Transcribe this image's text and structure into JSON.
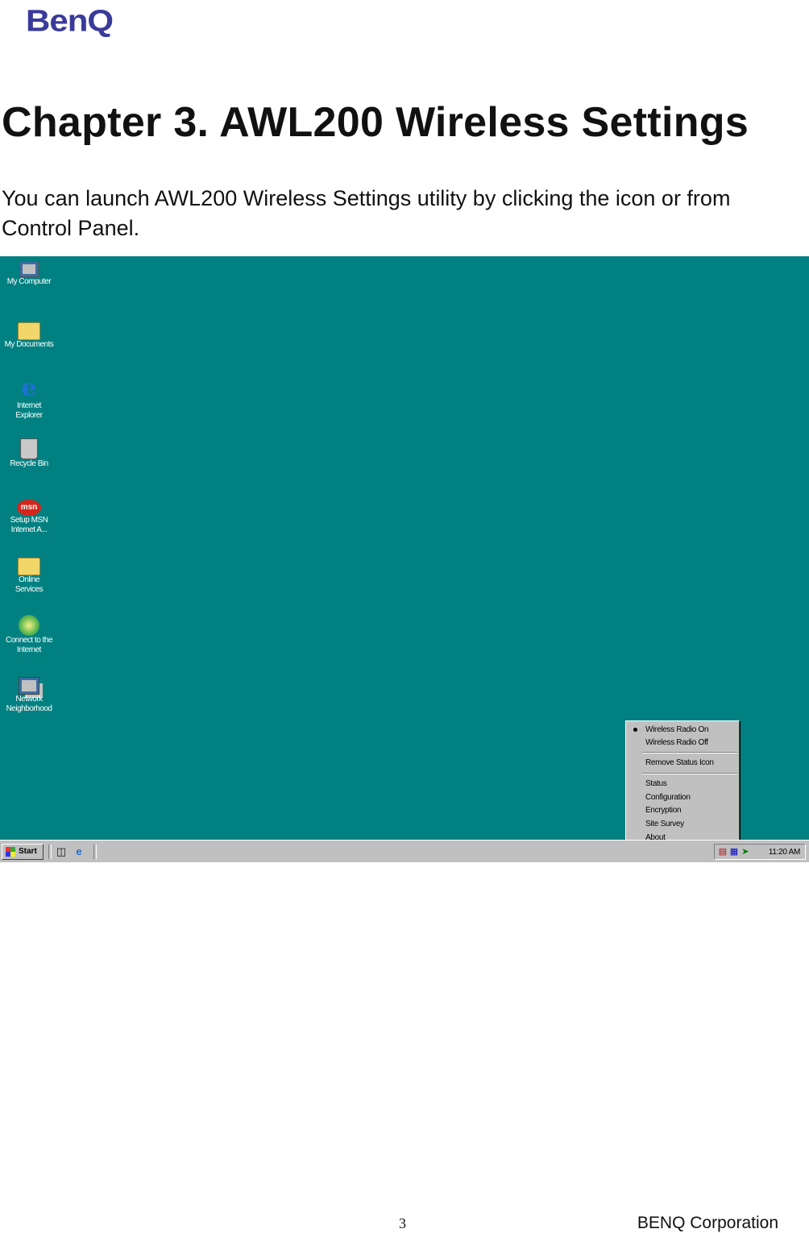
{
  "header": {
    "logo_text": "BenQ"
  },
  "chapter_title": "Chapter 3. AWL200 Wireless Settings",
  "intro_text": "You can launch AWL200 Wireless Settings utility by clicking the icon or from Control Panel.",
  "screenshot": {
    "background_color": "#008080",
    "desktop_icons": [
      {
        "label": "My Computer",
        "icon": "my-computer-icon"
      },
      {
        "label": "My Documents",
        "icon": "my-documents-icon"
      },
      {
        "label": "Internet Explorer",
        "icon": "internet-explorer-icon"
      },
      {
        "label": "Recycle Bin",
        "icon": "recycle-bin-icon"
      },
      {
        "label": "Setup MSN Internet A...",
        "icon": "msn-icon"
      },
      {
        "label": "Online Services",
        "icon": "folder-icon"
      },
      {
        "label": "Connect to the Internet",
        "icon": "connect-icon"
      },
      {
        "label": "Network Neighborhood",
        "icon": "network-icon"
      }
    ],
    "context_menu": {
      "items": [
        {
          "label": "Wireless Radio On",
          "checked": true
        },
        {
          "label": "Wireless Radio Off",
          "checked": false
        },
        {
          "label": "Remove Status Icon",
          "checked": false
        },
        {
          "label": "Status",
          "checked": false
        },
        {
          "label": "Configuration",
          "checked": false
        },
        {
          "label": "Encryption",
          "checked": false
        },
        {
          "label": "Site Survey",
          "checked": false
        },
        {
          "label": "About",
          "checked": false
        }
      ]
    },
    "taskbar": {
      "start_label": "Start",
      "clock": "11:20 AM"
    }
  },
  "footer": {
    "page_number": "3",
    "company": "BENQ Corporation"
  }
}
